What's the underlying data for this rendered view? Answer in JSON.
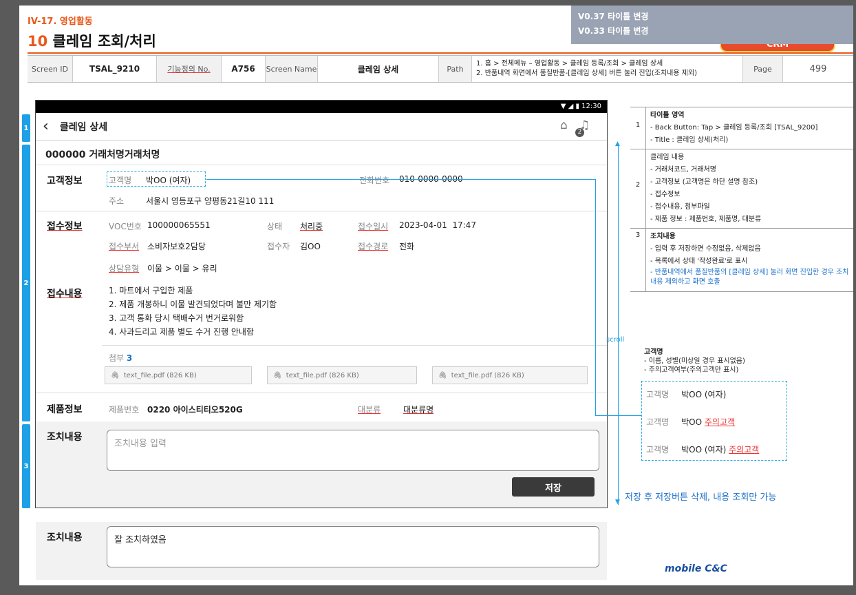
{
  "doc": {
    "section": "IV-17. 영업활동",
    "title_num": "10",
    "title": "클레임 조회/처리",
    "versions": [
      "V0.37 타이틀 변경",
      "V0.33 타이틀 변경"
    ],
    "badge": "CRM"
  },
  "header": {
    "screen_id_label": "Screen ID",
    "screen_id": "TSAL_9210",
    "func_label": "기능정의 No.",
    "func_no": "A756",
    "screen_name_label": "Screen Name",
    "screen_name": "클레임 상세",
    "path_label": "Path",
    "path_line1": "1. 홈 > 전체메뉴 – 영업활동 > 클레임 등록/조회 > 클레임 상세",
    "path_line2": "2. 반품내역 화면에서 품질반품-[클레임 상세] 버튼 눌러 진입(조치내용 제외)",
    "page_label": "Page",
    "page": "499"
  },
  "markers": [
    "1",
    "2",
    "3"
  ],
  "device": {
    "time": "12:30",
    "title": "클레임 상세",
    "badge_count": "2",
    "customer_title": "000000 거래처명거래처명",
    "customer": {
      "heading": "고객정보",
      "name_label": "고객명",
      "name": "박OO (여자)",
      "phone_label": "전화번호",
      "phone": "010-0000-0000",
      "address_label": "주소",
      "address": "서울시 영등포구 양평동21길10 111"
    },
    "receipt": {
      "heading": "접수정보",
      "voc_label": "VOC번호",
      "voc": "100000065551",
      "status_label": "상태",
      "status": "처리중",
      "date_label": "접수일시",
      "date": "2023-04-01  17:47",
      "dept_label": "접수부서",
      "dept": "소비자보호2담당",
      "person_label": "접수자",
      "person": "김OO",
      "route_label": "접수경로",
      "route": "전화",
      "type_label": "상담유형",
      "type": "이물 > 이물 > 유리"
    },
    "content": {
      "heading": "접수내용",
      "lines": [
        "1. 마트에서 구입한 제품",
        "2. 제품 개봉하니 이물 발견되었다며 불만 제기함",
        "3. 고객 통화 당시 택배수거 번거로워함",
        "4. 사과드리고 제품 별도 수거 진행 안내함"
      ],
      "attach_label": "첨부",
      "attach_count": "3",
      "files": [
        "text_file.pdf (826 KB)",
        "text_file.pdf (826 KB)",
        "text_file.pdf (826 KB)"
      ]
    },
    "product": {
      "heading": "제품정보",
      "no_label": "제품번호",
      "no": "0220 아이스티티오520G",
      "cat_label": "대분류",
      "cat": "대분류명"
    },
    "action": {
      "heading": "조치내용",
      "placeholder": "조치내용 입력",
      "save": "저장"
    }
  },
  "bottom_action": {
    "heading": "조치내용",
    "value": "잘 조치하였음"
  },
  "desc": {
    "rows": [
      {
        "num": "1",
        "title": "타이틀 영역",
        "items": [
          "-   Back Button: Tap > 클레임 등록/조회 [TSAL_9200]",
          "-   Title : 클레임 상세(처리)"
        ]
      },
      {
        "num": "2",
        "title": "클레임 내용",
        "items": [
          "-   거래처코드, 거래처명",
          "-   고객정보 (고객명은 하단 설명 참조)",
          "-   접수정보",
          "-   접수내용, 첨부파일",
          "-   제품 정보 : 제품번호, 제품명, 대분류"
        ]
      },
      {
        "num": "3",
        "title": "조치내용",
        "items": [
          "-   입력 후 저장하면 수정없음, 삭제없음",
          "-   목록에서 상태 '작성완료'로 표시"
        ],
        "blue": "-   반품내역에서 품질반품의 [클레임 상세] 눌러 화면 진입한 경우 조치내용 제외하고 화면 호출"
      }
    ]
  },
  "scroll_label": "scroll",
  "notes": {
    "title": "고객명",
    "l1": "-    이름, 성별(미상일 경우 표시없음)",
    "l2": "-    주의고객여부(주의고객만 표시)",
    "variants": [
      {
        "label": "고객명",
        "value": "박OO (여자)",
        "warn": ""
      },
      {
        "label": "고객명",
        "value": "박OO",
        "warn": "주의고객"
      },
      {
        "label": "고객명",
        "value": "박OO (여자)",
        "warn": "주의고객"
      }
    ]
  },
  "after_save_note": "저장 후 저장버튼 삭제, 내용 조회만 가능",
  "logo": "mobile C&C"
}
